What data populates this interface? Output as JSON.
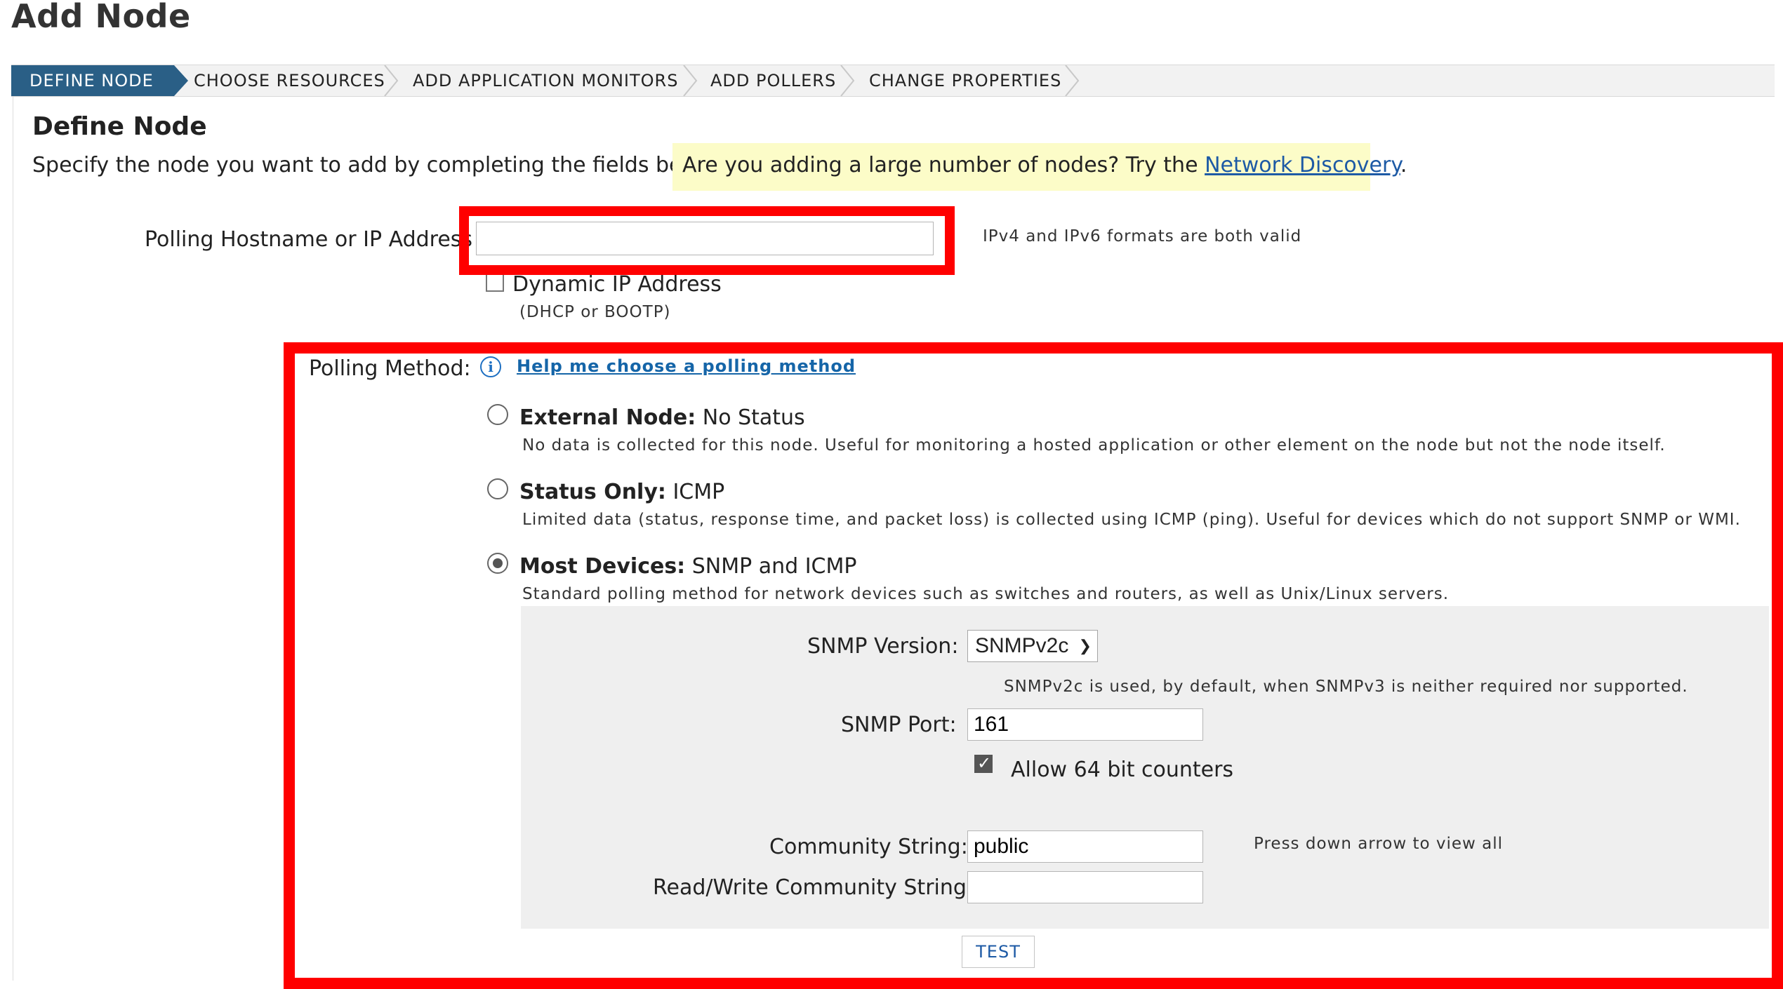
{
  "page_title": "Add Node",
  "wizard": {
    "steps": [
      "DEFINE NODE",
      "CHOOSE RESOURCES",
      "ADD APPLICATION MONITORS",
      "ADD POLLERS",
      "CHANGE PROPERTIES"
    ]
  },
  "section": {
    "title": "Define Node",
    "intro": "Specify the node you want to add by completing the fields below.",
    "hint_prefix": "Are you adding a large number of nodes? Try the ",
    "hint_link": "Network Discovery",
    "hint_suffix": "."
  },
  "hostname": {
    "label": "Polling Hostname or IP Address",
    "value": "",
    "note": "IPv4 and IPv6 formats are both valid"
  },
  "dynamic_ip": {
    "label": "Dynamic IP Address",
    "sub": "(DHCP or BOOTP)",
    "checked": false
  },
  "polling": {
    "label": "Polling Method:",
    "help_link": "Help me choose a polling method",
    "options": [
      {
        "title": "External Node:",
        "method": "No Status",
        "desc": "No data is collected for this node. Useful for monitoring a hosted application or other element on the node but not the node itself.",
        "selected": false
      },
      {
        "title": "Status Only:",
        "method": "ICMP",
        "desc": "Limited data (status, response time, and packet loss) is collected using ICMP (ping). Useful for devices which do not support SNMP or WMI.",
        "selected": false
      },
      {
        "title": "Most Devices:",
        "method": "SNMP and ICMP",
        "desc": "Standard polling method for network devices such as switches and routers, as well as Unix/Linux servers.",
        "selected": true
      }
    ]
  },
  "snmp": {
    "version_label": "SNMP Version:",
    "version_value": "SNMPv2c",
    "version_note": "SNMPv2c is used, by default, when SNMPv3 is neither required nor supported.",
    "port_label": "SNMP Port:",
    "port_value": "161",
    "counters_label": "Allow 64 bit counters",
    "counters_checked": true,
    "community_label": "Community String:",
    "community_value": "public",
    "community_note": "Press down arrow to view all",
    "rw_label": "Read/Write Community String:",
    "rw_value": "",
    "test_label": "TEST"
  },
  "colors": {
    "accent": "#2a5f86",
    "highlight": "#ff0000",
    "hint_bg": "#fcfcc8",
    "link": "#1d5aa5"
  }
}
